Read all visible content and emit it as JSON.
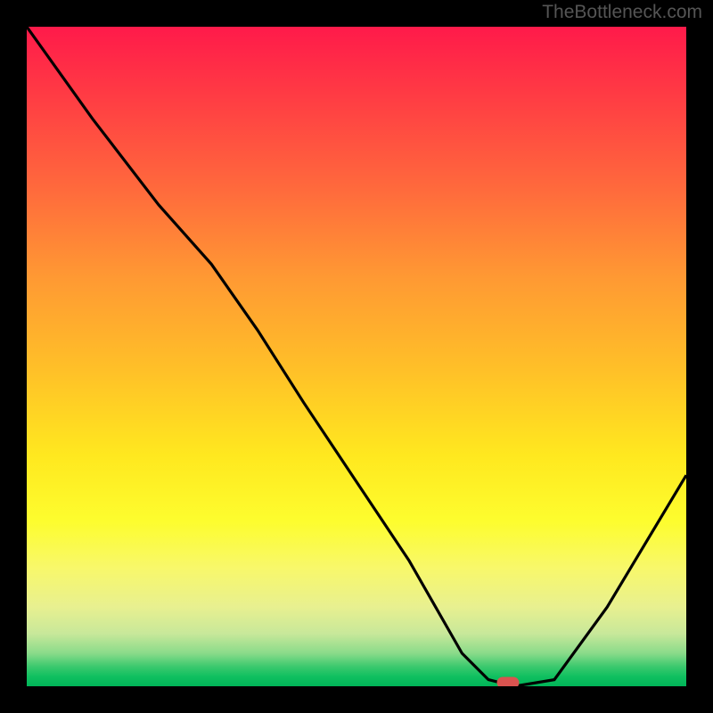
{
  "watermark_text": "TheBottleneck.com",
  "chart_data": {
    "type": "line",
    "title": "",
    "xlabel": "",
    "ylabel": "",
    "xlim": [
      0,
      100
    ],
    "ylim": [
      0,
      100
    ],
    "series": [
      {
        "name": "curve",
        "x": [
          0,
          10,
          20,
          28,
          35,
          42,
          50,
          58,
          62,
          66,
          70,
          74,
          80,
          88,
          100
        ],
        "y": [
          100,
          86,
          73,
          64,
          54,
          43,
          31,
          19,
          12,
          5,
          1,
          0,
          1,
          12,
          32
        ]
      }
    ],
    "marker": {
      "x": 73,
      "y": 0.5,
      "color": "#d9534f"
    },
    "background_gradient": {
      "stops": [
        {
          "pos": 0.0,
          "color": "#ff1a4a"
        },
        {
          "pos": 0.5,
          "color": "#ffc028"
        },
        {
          "pos": 0.8,
          "color": "#fdfd2e"
        },
        {
          "pos": 1.0,
          "color": "#00b558"
        }
      ]
    }
  }
}
